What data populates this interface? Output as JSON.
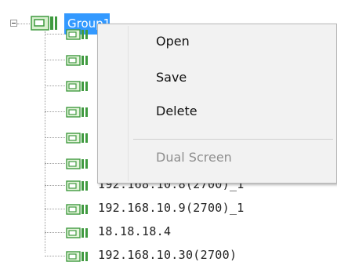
{
  "tree": {
    "group_label": "Group1",
    "items": [
      {
        "label": ""
      },
      {
        "label": ""
      },
      {
        "label": ""
      },
      {
        "label": ""
      },
      {
        "label": ""
      },
      {
        "label": ""
      },
      {
        "label": "192.168.10.8(2700)_1"
      },
      {
        "label": "192.168.10.9(2700)_1"
      },
      {
        "label": "18.18.18.4"
      },
      {
        "label": "192.168.10.30(2700)"
      }
    ]
  },
  "context_menu": {
    "items": [
      {
        "label": "Open",
        "enabled": true
      },
      {
        "label": "Save",
        "enabled": true
      },
      {
        "label": "Delete",
        "enabled": true
      },
      {
        "label": "Dual Screen",
        "enabled": false
      }
    ]
  },
  "colors": {
    "selection": "#3399ff",
    "camera_icon": "#3f9a3f",
    "menu_bg": "#f2f2f2"
  },
  "icons": {
    "expander": "collapse-minus-icon",
    "group": "camera-group-icon",
    "item": "camera-icon"
  }
}
